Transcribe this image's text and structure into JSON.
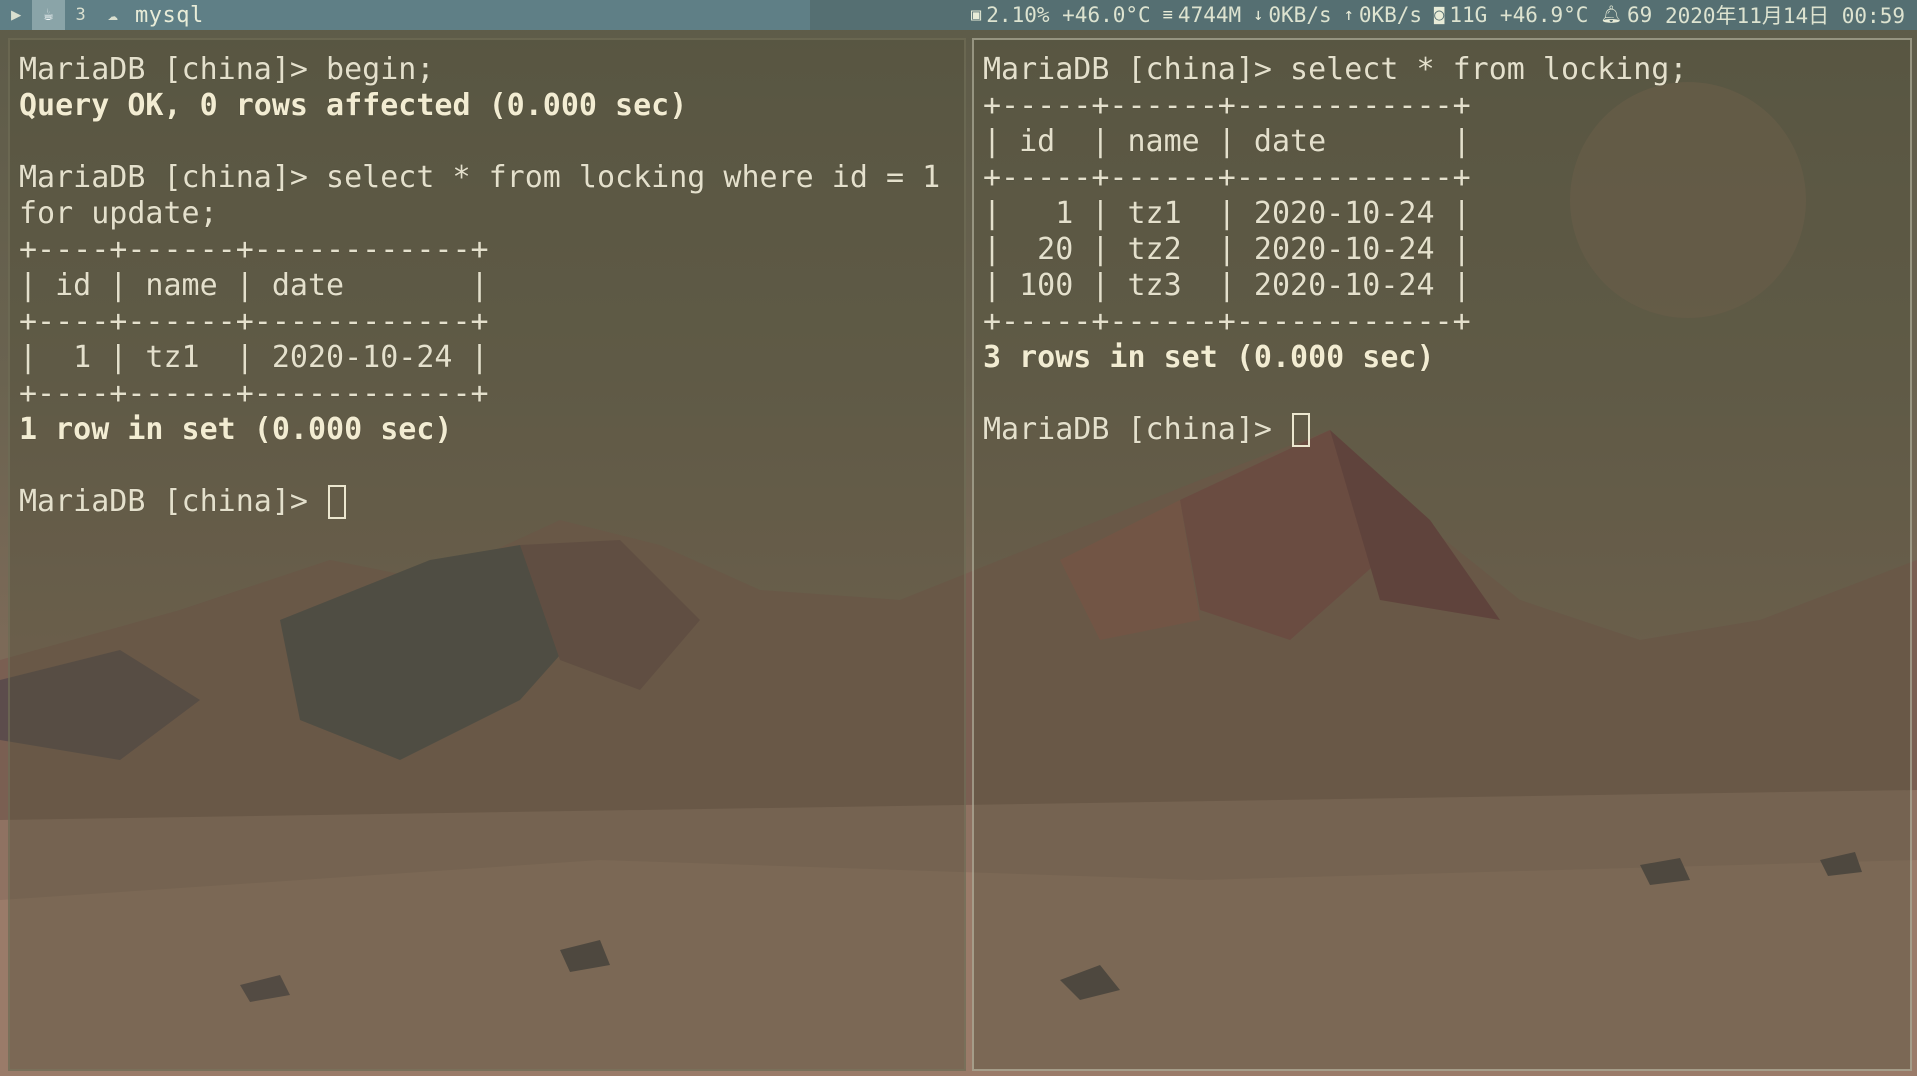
{
  "topbar": {
    "workspaces": [
      {
        "icon": "terminal-icon",
        "glyph": "▶"
      },
      {
        "icon": "coffee-icon",
        "glyph": "☕"
      },
      {
        "icon": "workspace-3-icon",
        "glyph": "3"
      },
      {
        "icon": "cloud-icon",
        "glyph": "☁"
      }
    ],
    "window_title": "mysql",
    "status": {
      "cpu": "2.10%",
      "cpu_temp": "+46.0°C",
      "memory": "4744M",
      "down": "0KB/s",
      "up": "0KB/s",
      "disk": "11G",
      "disk_temp": "+46.9°C",
      "notifications": "69",
      "datetime": "2020年11月14日  00:59"
    }
  },
  "left_terminal": {
    "lines": [
      {
        "text": "MariaDB [china]> begin;",
        "bold": false
      },
      {
        "text": "Query OK, 0 rows affected (0.000 sec)",
        "bold": true
      },
      {
        "text": "",
        "bold": false
      },
      {
        "text": "MariaDB [china]> select * from locking where id = 1",
        "bold": false
      },
      {
        "text": "for update;",
        "bold": false
      },
      {
        "text": "+----+------+------------+",
        "bold": false
      },
      {
        "text": "| id | name | date       |",
        "bold": false
      },
      {
        "text": "+----+------+------------+",
        "bold": false
      },
      {
        "text": "|  1 | tz1  | 2020-10-24 |",
        "bold": false
      },
      {
        "text": "+----+------+------------+",
        "bold": false
      },
      {
        "text": "1 row in set (0.000 sec)",
        "bold": true
      },
      {
        "text": "",
        "bold": false
      }
    ],
    "prompt": "MariaDB [china]> "
  },
  "right_terminal": {
    "lines": [
      {
        "text": "MariaDB [china]> select * from locking;",
        "bold": false
      },
      {
        "text": "+-----+------+------------+",
        "bold": false
      },
      {
        "text": "| id  | name | date       |",
        "bold": false
      },
      {
        "text": "+-----+------+------------+",
        "bold": false
      },
      {
        "text": "|   1 | tz1  | 2020-10-24 |",
        "bold": false
      },
      {
        "text": "|  20 | tz2  | 2020-10-24 |",
        "bold": false
      },
      {
        "text": "| 100 | tz3  | 2020-10-24 |",
        "bold": false
      },
      {
        "text": "+-----+------+------------+",
        "bold": false
      },
      {
        "text": "3 rows in set (0.000 sec)",
        "bold": true
      },
      {
        "text": "",
        "bold": false
      }
    ],
    "prompt": "MariaDB [china]> "
  },
  "colors": {
    "topbar_bg": "#5f7f86",
    "status_bg": "#556f72",
    "terminal_text": "#e4e0cc"
  }
}
